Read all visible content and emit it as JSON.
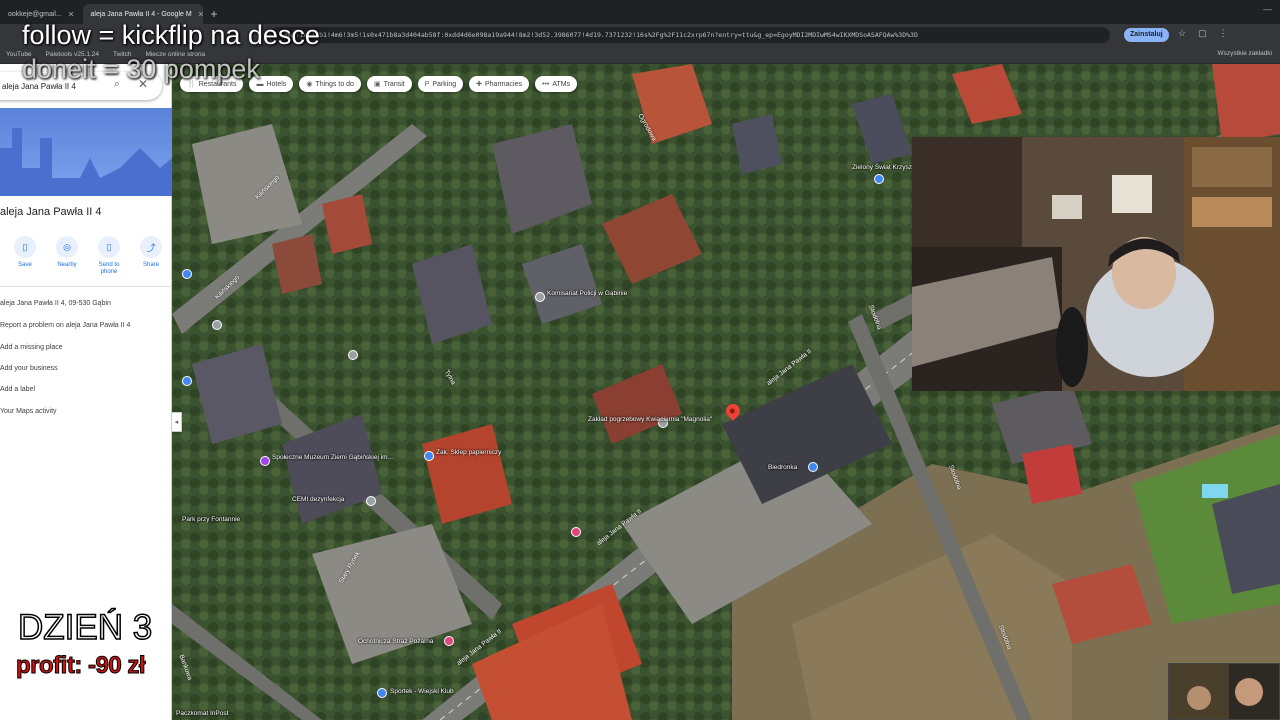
{
  "browser": {
    "tabs": [
      {
        "label": "ookkeje@gmail...",
        "active": false
      },
      {
        "label": "aleja Jana Pawła II 4 - Google M",
        "active": true
      }
    ],
    "url": "=3m1!1e3!4b1!4m6!3m5!1s0x471b8a3d404ab58f:0xdd4d6e098a19a944!8m2!3d52.3986077!4d19.7371232!16s%2Fg%2F11c2xrp67n?entry=ttu&g_ep=EgoyMDI2MDIwMS4wIKXMDSoASAFQAw%3D%3D",
    "update_label": "Zainstaluj",
    "bookmarks": [
      "YouTube",
      "Paletools v25.1.24",
      "Twitch",
      "Miecze online strona"
    ],
    "bookmarks_right": "Wszystkie zakładki"
  },
  "panel": {
    "search_value": "aleja Jana Pawła II 4",
    "place_title": "aleja Jana Pawła II 4",
    "actions": [
      {
        "label": "Save",
        "icon": "bookmark-icon",
        "glyph": "▯"
      },
      {
        "label": "Nearby",
        "icon": "nearby-icon",
        "glyph": "◎"
      },
      {
        "label": "Send to phone",
        "icon": "phone-icon",
        "glyph": "▯"
      },
      {
        "label": "Share",
        "icon": "share-icon",
        "glyph": "⤴"
      }
    ],
    "info_rows": [
      "aleja Jana Pawła II 4, 09-530 Gąbin",
      "Report a problem on aleja Jana Pawła II 4",
      "Add a missing place",
      "Add your business",
      "Add a label",
      "Your Maps activity"
    ]
  },
  "map": {
    "chips": [
      {
        "label": "Restaurants",
        "glyph": "🍴"
      },
      {
        "label": "Hotels",
        "glyph": "▬"
      },
      {
        "label": "Things to do",
        "glyph": "◉"
      },
      {
        "label": "Transit",
        "glyph": "▣"
      },
      {
        "label": "Parking",
        "glyph": "P"
      },
      {
        "label": "Pharmacies",
        "glyph": "✚"
      },
      {
        "label": "ATMs",
        "glyph": "•••"
      }
    ],
    "streets": [
      "aleja Jana Pawła II",
      "aleja Jana Pawła II",
      "aleja Jana Pawła II",
      "Kilińskiego",
      "Kilińskiego",
      "Tylna",
      "Stary Rynek",
      "Stodolna",
      "Stodolna",
      "Stodolna",
      "Ogrodowa",
      "Bankowa"
    ],
    "labels": [
      "Zielony Świat Krzysztofa",
      "Komisariat Policji w Gąbinie",
      "Zakład pogrzebowy Kwiaciarnia \"Magnolia\"",
      "Biedronka",
      "Zak. Sklep papierniczy",
      "Społeczne Muzeum Ziemi Gąbińskiej im...",
      "CEMI dezynfekcja",
      "Ochotnicza Straż Pożarna",
      "Sportek - Wiejski Klub",
      "Park przy Fontannie",
      "Paczkomat InPost"
    ]
  },
  "overlay": {
    "line1": "follow = kickflip na desce",
    "line2": "doneit = 30 pompek",
    "day": "DZIEŃ 3",
    "profit": "profit: -90 zł"
  }
}
